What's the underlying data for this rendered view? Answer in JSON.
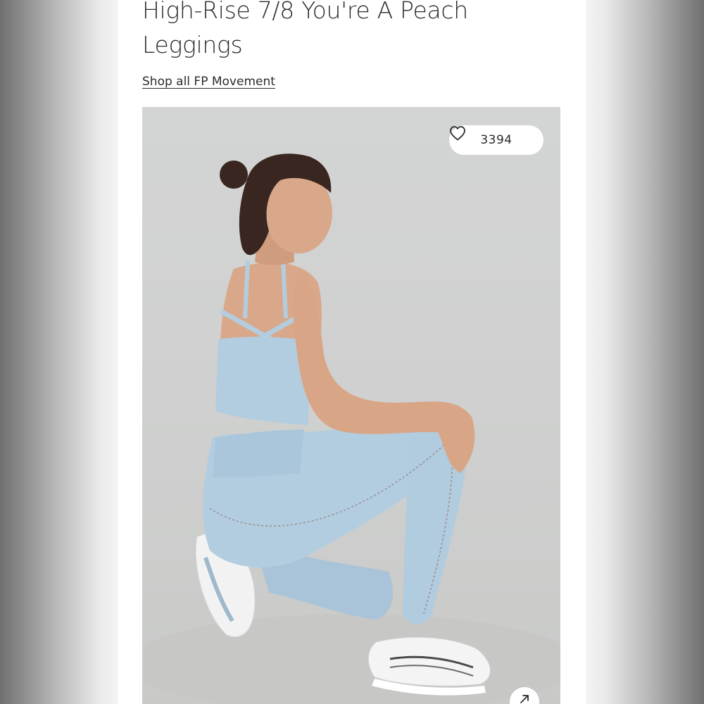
{
  "product": {
    "title": "High-Rise 7/8 You're A Peach Leggings",
    "shop_link": "Shop all FP Movement"
  },
  "image": {
    "like_count": "3394",
    "like_icon": "heart-outline-icon",
    "expand_icon": "arrow-up-right-icon"
  },
  "colors": {
    "outer_background": "#f4f4f4",
    "page_background": "#ffffff",
    "text": "#2b2b2b",
    "photo_background": "#d1d2d1",
    "apparel": "#b3cde0"
  }
}
